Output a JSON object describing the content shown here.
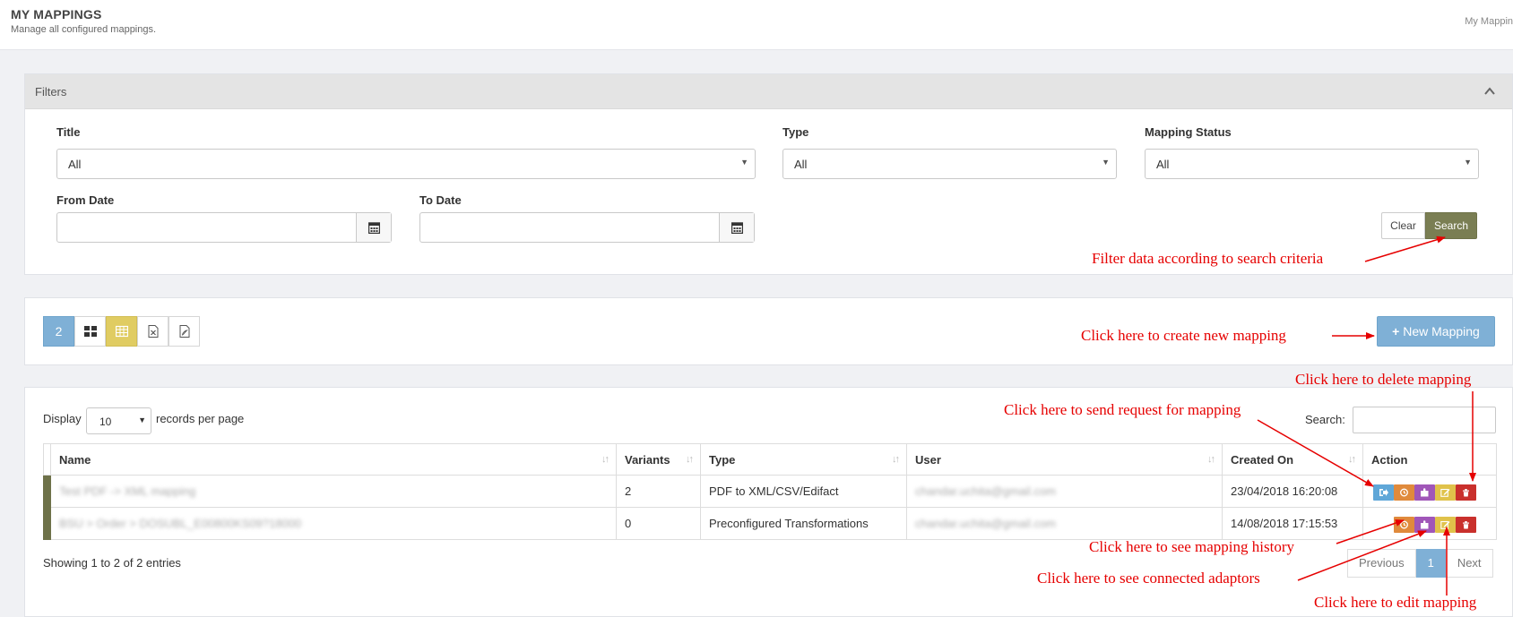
{
  "header": {
    "title": "MY MAPPINGS",
    "subtitle": "Manage all configured mappings.",
    "breadcrumb": "My Mappin"
  },
  "filters": {
    "panel_title": "Filters",
    "title_label": "Title",
    "title_value": "All",
    "type_label": "Type",
    "type_value": "All",
    "status_label": "Mapping Status",
    "status_value": "All",
    "from_label": "From Date",
    "to_label": "To Date",
    "clear_label": "Clear",
    "search_label": "Search"
  },
  "toolbar": {
    "count": "2",
    "new_label": "New Mapping",
    "views": [
      "grid-view-icon",
      "table-view-icon",
      "excel-export-icon",
      "pdf-export-icon"
    ]
  },
  "table": {
    "display_label": "Display",
    "per_page_value": "10",
    "per_page_label": "records per page",
    "search_label": "Search:",
    "columns": [
      "Name",
      "Variants",
      "Type",
      "User",
      "Created On",
      "Action"
    ],
    "rows": [
      {
        "name": "Test PDF -> XML mapping",
        "variants": "2",
        "type": "PDF to XML/CSV/Edifact",
        "user": "chandar.uchita@gmail.com",
        "created": "23/04/2018 16:20:08"
      },
      {
        "name": "BSU > Order > DOSUBL_E00800KS09?18000",
        "variants": "0",
        "type": "Preconfigured Transformations",
        "user": "chandar.uchita@gmail.com",
        "created": "14/08/2018 17:15:53"
      }
    ],
    "showing": "Showing 1 to 2 of 2 entries",
    "prev_label": "Previous",
    "page": "1",
    "next_label": "Next"
  },
  "colors": {
    "accent_blue": "#7fb0d6",
    "olive": "#7a7e53",
    "action_request": "#5fa7d8",
    "action_history": "#e08a3c",
    "action_adaptor": "#a056b8",
    "action_edit": "#e0c24a",
    "action_delete": "#c9302c",
    "annotation": "#e60000"
  },
  "annotations": {
    "filter": "Filter data according to search criteria",
    "new": "Click here to create new mapping",
    "delete": "Click here to delete mapping",
    "request": "Click here to send request for mapping",
    "history": "Click here to see mapping history",
    "adaptors": "Click here to see connected adaptors",
    "edit": "Click here to edit mapping"
  }
}
